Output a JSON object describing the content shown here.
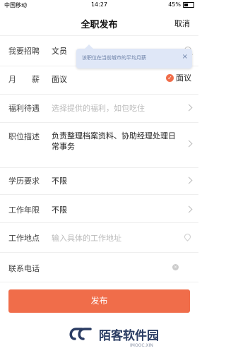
{
  "status": {
    "carrier": "中国移动",
    "time": "14:27",
    "battery": "45%"
  },
  "header": {
    "title": "全职发布",
    "cancel": "取消"
  },
  "form": {
    "job": {
      "label": "我要招聘",
      "value": "文员"
    },
    "salary": {
      "label": "月　　薪",
      "value": "面议",
      "negotiable": "面议"
    },
    "benefits": {
      "label": "福利待遇",
      "placeholder": "选择提供的福利，如包吃住"
    },
    "description": {
      "label": "职位描述",
      "value": "负责整理档案资料、协助经理处理日常事务"
    },
    "education": {
      "label": "学历要求",
      "value": "不限"
    },
    "experience": {
      "label": "工作年限",
      "value": "不限"
    },
    "location": {
      "label": "工作地点",
      "placeholder": "输入具体的工作地址"
    },
    "phone": {
      "label": "联系电话",
      "value": ""
    }
  },
  "tooltip": {
    "text": "该职位在当前城市的平均月薪",
    "close": "×"
  },
  "submit": {
    "label": "发布"
  },
  "watermark": {
    "cn": "陌客软件园",
    "en": "IMOOC.XIN"
  },
  "colors": {
    "accent": "#f06d4a",
    "tooltip_bg": "#dfe7f7"
  }
}
